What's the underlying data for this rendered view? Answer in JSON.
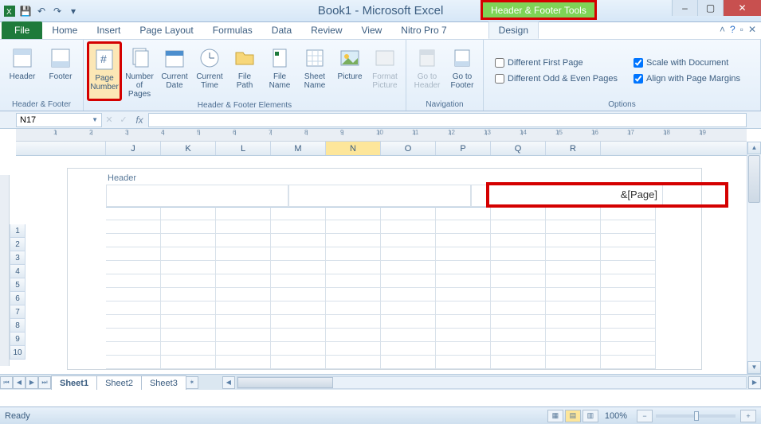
{
  "title": "Book1 - Microsoft Excel",
  "context_tab": "Header & Footer Tools",
  "window": {
    "min": "–",
    "max": "▢",
    "close": "✕",
    "restore": "▾"
  },
  "qat": {
    "save": "💾",
    "undo": "↶",
    "redo": "↷"
  },
  "tabs": {
    "file": "File",
    "list": [
      "Home",
      "Insert",
      "Page Layout",
      "Formulas",
      "Data",
      "Review",
      "View",
      "Nitro Pro 7"
    ],
    "design": "Design"
  },
  "ribbon": {
    "groups": {
      "hf": "Header & Footer",
      "elements": "Header & Footer Elements",
      "nav": "Navigation",
      "options": "Options"
    },
    "btns": {
      "header": "Header",
      "footer": "Footer",
      "page_number": "Page\nNumber",
      "num_pages": "Number\nof Pages",
      "cur_date": "Current\nDate",
      "cur_time": "Current\nTime",
      "file_path": "File\nPath",
      "file_name": "File\nName",
      "sheet_name": "Sheet\nName",
      "picture": "Picture",
      "format_picture": "Format\nPicture",
      "goto_header": "Go to\nHeader",
      "goto_footer": "Go to\nFooter"
    },
    "checks": {
      "diff_first": "Different First Page",
      "diff_oddeven": "Different Odd & Even Pages",
      "scale_doc": "Scale with Document",
      "align_margins": "Align with Page Margins"
    }
  },
  "formula_bar": {
    "name_box": "N17",
    "fx": "fx",
    "value": ""
  },
  "columns": [
    "J",
    "K",
    "L",
    "M",
    "N",
    "O",
    "P",
    "Q",
    "R"
  ],
  "active_col": "N",
  "rows": [
    1,
    2,
    3,
    4,
    5,
    6,
    7,
    8,
    9,
    10
  ],
  "header_section": {
    "label": "Header",
    "right_value": "&[Page]"
  },
  "sheet_tabs": [
    "Sheet1",
    "Sheet2",
    "Sheet3"
  ],
  "active_sheet": "Sheet1",
  "status": {
    "ready": "Ready",
    "zoom": "100%"
  },
  "ruler_marks": [
    1,
    2,
    3,
    4,
    5,
    6,
    7,
    8,
    9,
    10,
    11,
    12,
    13,
    14,
    15,
    16,
    17,
    18,
    19
  ]
}
